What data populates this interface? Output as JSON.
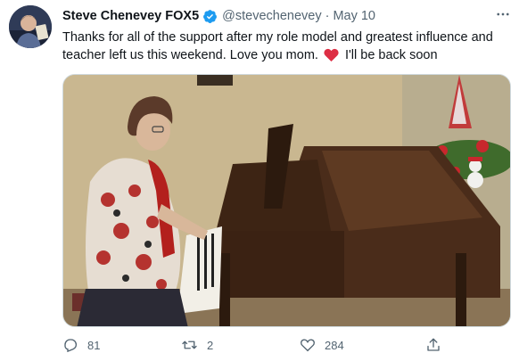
{
  "tweet": {
    "author_name": "Steve Chenevey FOX5",
    "handle": "@stevechenevey",
    "separator": "·",
    "date": "May 10",
    "text_before_heart": "Thanks for all of the support after my role model and greatest influence and teacher left us this weekend. Love you mom.",
    "text_after_heart": "I'll be back soon",
    "heart_emoji_color": "#dd2e44",
    "verified_badge_color": "#1d9bf0",
    "media_description_icon": "photo-woman-playing-piano"
  },
  "actions": {
    "reply_count": "81",
    "retweet_count": "2",
    "like_count": "284"
  },
  "colors": {
    "text_primary": "#0f1419",
    "text_secondary": "#536471",
    "border": "#cfd9de"
  }
}
